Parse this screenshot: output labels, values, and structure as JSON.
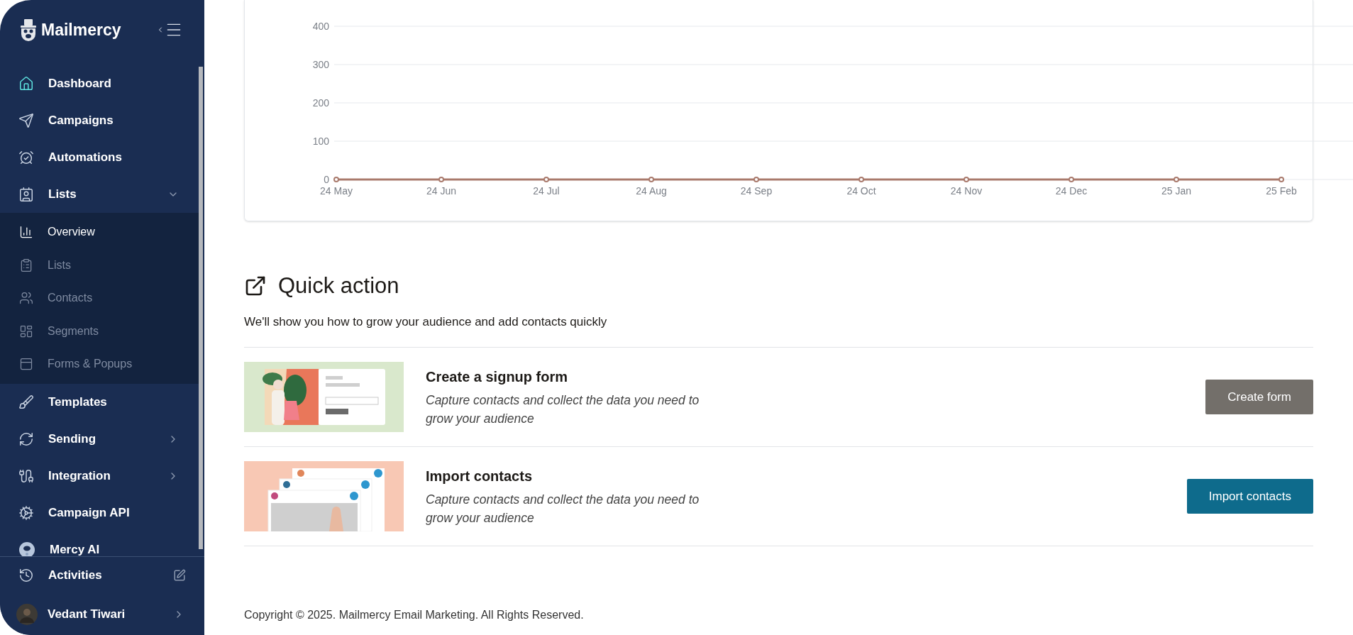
{
  "brand": {
    "name": "Mailmercy"
  },
  "nav": [
    {
      "label": "Dashboard"
    },
    {
      "label": "Campaigns"
    },
    {
      "label": "Automations"
    },
    {
      "label": "Lists",
      "expanded": true,
      "children": [
        {
          "label": "Overview",
          "selected": true
        },
        {
          "label": "Lists",
          "selected": false
        },
        {
          "label": "Contacts",
          "selected": false
        },
        {
          "label": "Segments",
          "selected": false
        },
        {
          "label": "Forms & Popups",
          "selected": false
        }
      ]
    },
    {
      "label": "Templates"
    },
    {
      "label": "Sending",
      "expanded": false
    },
    {
      "label": "Integration",
      "expanded": false
    },
    {
      "label": "Campaign API"
    },
    {
      "label": "Mercy AI"
    }
  ],
  "footer_nav": [
    {
      "label": "Activities"
    }
  ],
  "user": {
    "name": "Vedant Tiwari"
  },
  "chart": {
    "chart_data": {
      "type": "line",
      "categories": [
        "24 May",
        "24 Jun",
        "24 Jul",
        "24 Aug",
        "24 Sep",
        "24 Oct",
        "24 Nov",
        "24 Dec",
        "25 Jan",
        "25 Feb"
      ],
      "series": [
        {
          "color": "#a97a6c",
          "marker": "circle",
          "values": [
            0,
            0,
            0,
            0,
            0,
            0,
            0,
            0,
            0,
            0
          ]
        }
      ],
      "ylim": [
        0,
        400
      ],
      "yticks": [
        0,
        100,
        200,
        300,
        400
      ],
      "grid": true
    }
  },
  "quick_action": {
    "title": "Quick action",
    "subtitle": "We'll show you how to grow your audience and add contacts quickly",
    "actions": [
      {
        "kind": "signup",
        "title": "Create a signup form",
        "description": "Capture contacts and collect the data you need to grow your audience",
        "button": "Create form"
      },
      {
        "kind": "import",
        "title": "Import contacts",
        "description": "Capture contacts and collect the data you need to grow your audience",
        "button": "Import contacts"
      }
    ]
  },
  "copyright": "Copyright © 2025. Mailmercy Email Marketing. All Rights Reserved."
}
